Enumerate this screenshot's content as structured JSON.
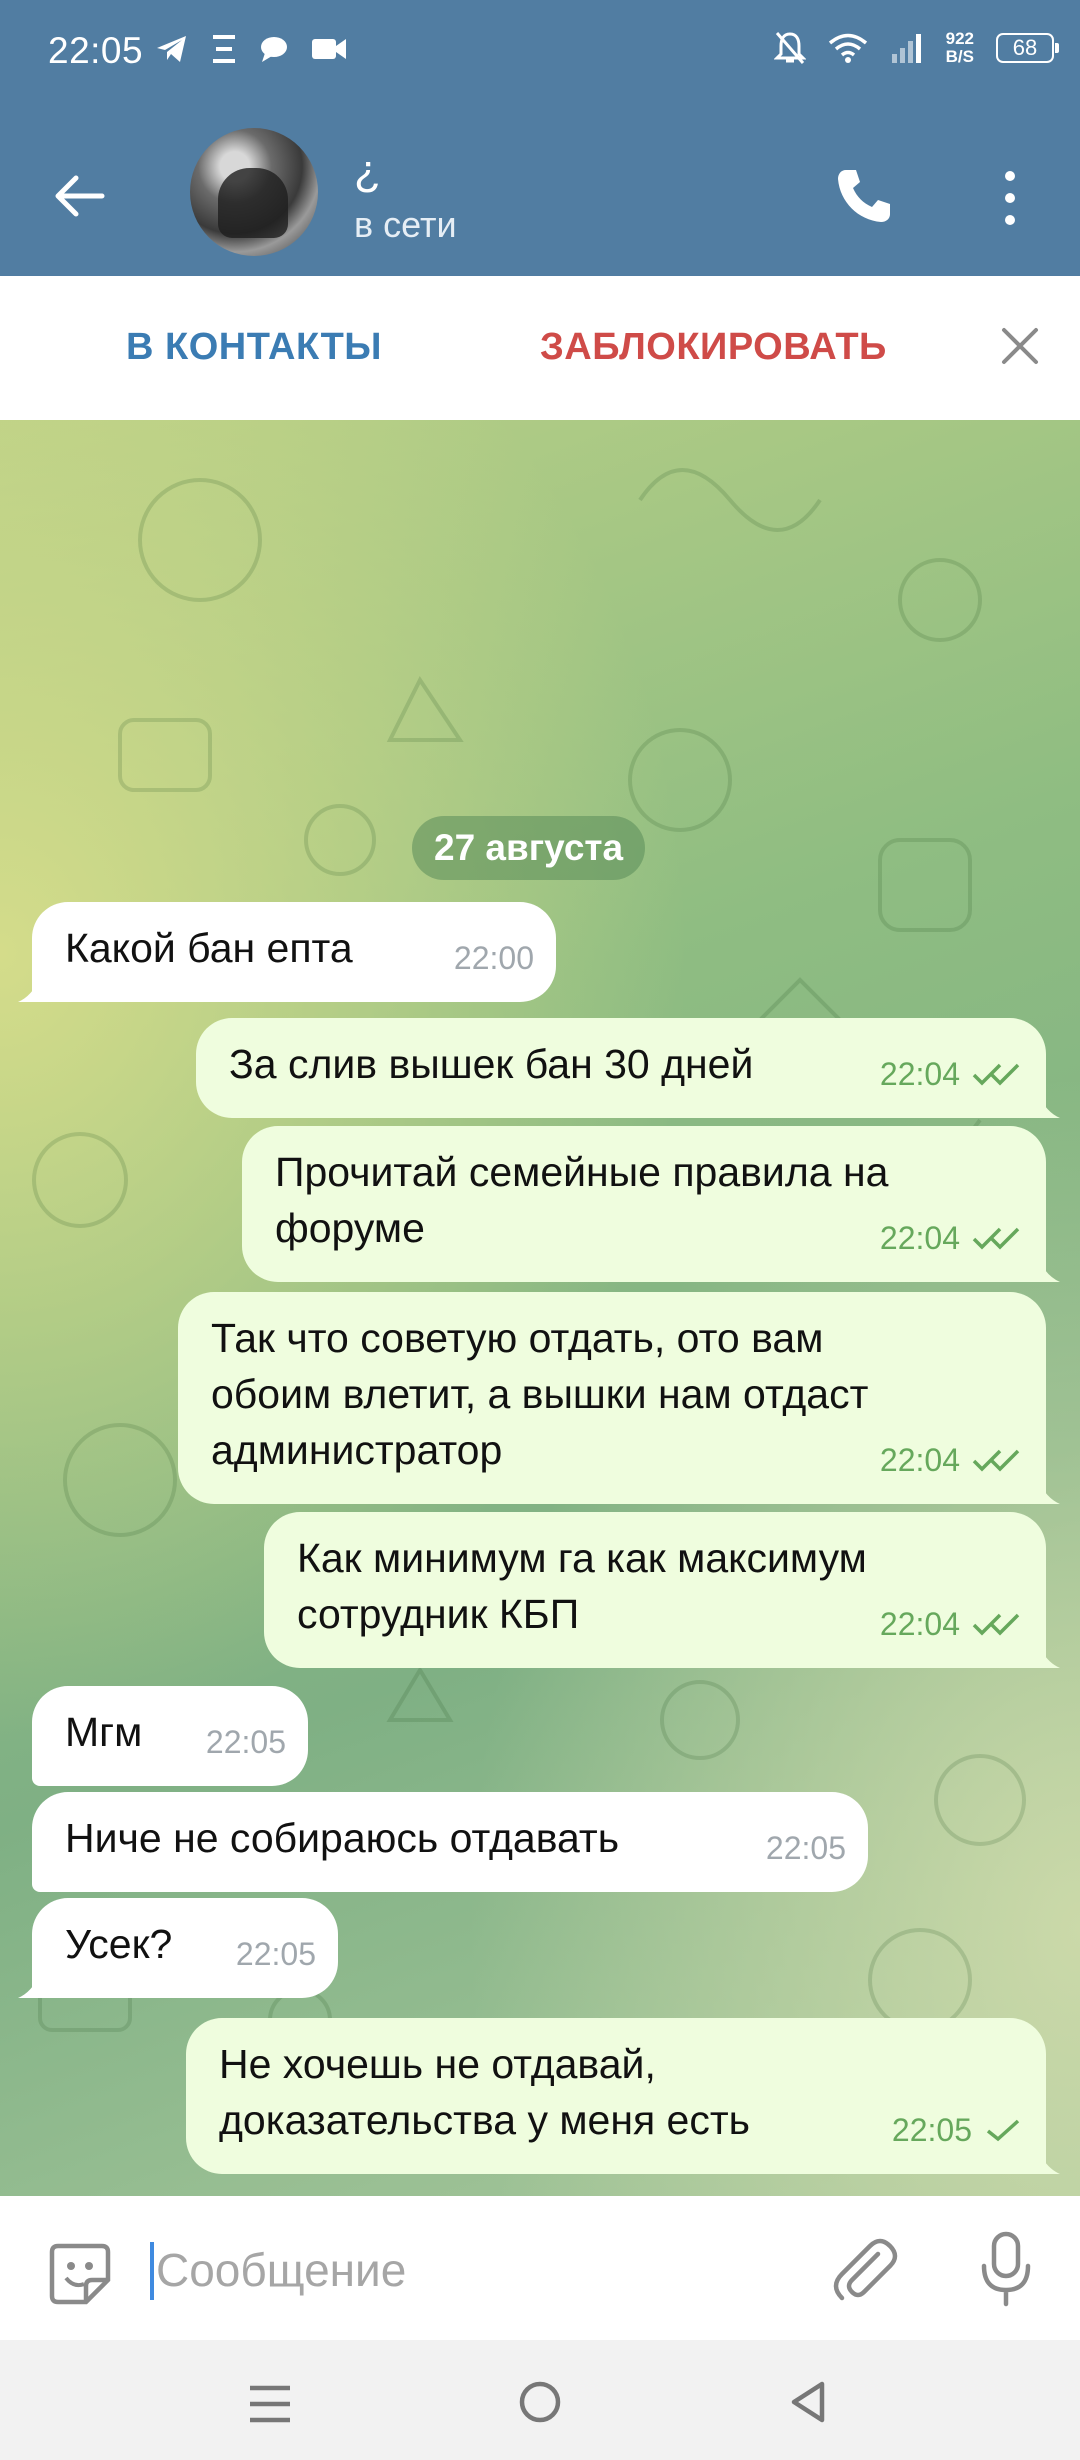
{
  "status_bar": {
    "time": "22:05",
    "net_speed_value": "922",
    "net_speed_unit": "B/S",
    "battery": "68",
    "left_icons": [
      "telegram-icon",
      "xi-icon",
      "chat-icon",
      "video-icon"
    ],
    "right_icons": [
      "mute-icon",
      "wifi-icon",
      "signal-icon"
    ]
  },
  "header": {
    "name": "¿",
    "status": "в сети"
  },
  "action_bar": {
    "add_contact": "В КОНТАКТЫ",
    "block": "ЗАБЛОКИРОВАТЬ"
  },
  "chat": {
    "date": "27 августа",
    "messages": [
      {
        "dir": "in",
        "text": "Какой бан епта",
        "time": "22:00"
      },
      {
        "dir": "out",
        "text": "За слив вышек бан 30 дней",
        "time": "22:04",
        "status": "read"
      },
      {
        "dir": "out",
        "text": "Прочитай семейные правила на\nфоруме",
        "time": "22:04",
        "status": "read"
      },
      {
        "dir": "out",
        "text": "Так что советую отдать, ото вам\nобоим влетит, а вышки нам отдаст\nадминистратор",
        "time": "22:04",
        "status": "read"
      },
      {
        "dir": "out",
        "text": "Как минимум га как максимум\nсотрудник КБП",
        "time": "22:04",
        "status": "read"
      },
      {
        "dir": "in",
        "text": "Мгм",
        "time": "22:05"
      },
      {
        "dir": "in",
        "text": "Ниче не собираюсь отдавать",
        "time": "22:05"
      },
      {
        "dir": "in",
        "text": "Усек?",
        "time": "22:05"
      },
      {
        "dir": "out",
        "text": "Не хочешь не отдавай,\nдоказательства у меня есть",
        "time": "22:05",
        "status": "sent"
      }
    ]
  },
  "input": {
    "placeholder": "Сообщение",
    "value": ""
  },
  "colors": {
    "header_bg": "#517da2",
    "add_contact": "#3b7cb3",
    "block": "#cf4b48",
    "bubble_in": "#ffffff",
    "bubble_out": "#effdde",
    "check": "#66a85c"
  }
}
